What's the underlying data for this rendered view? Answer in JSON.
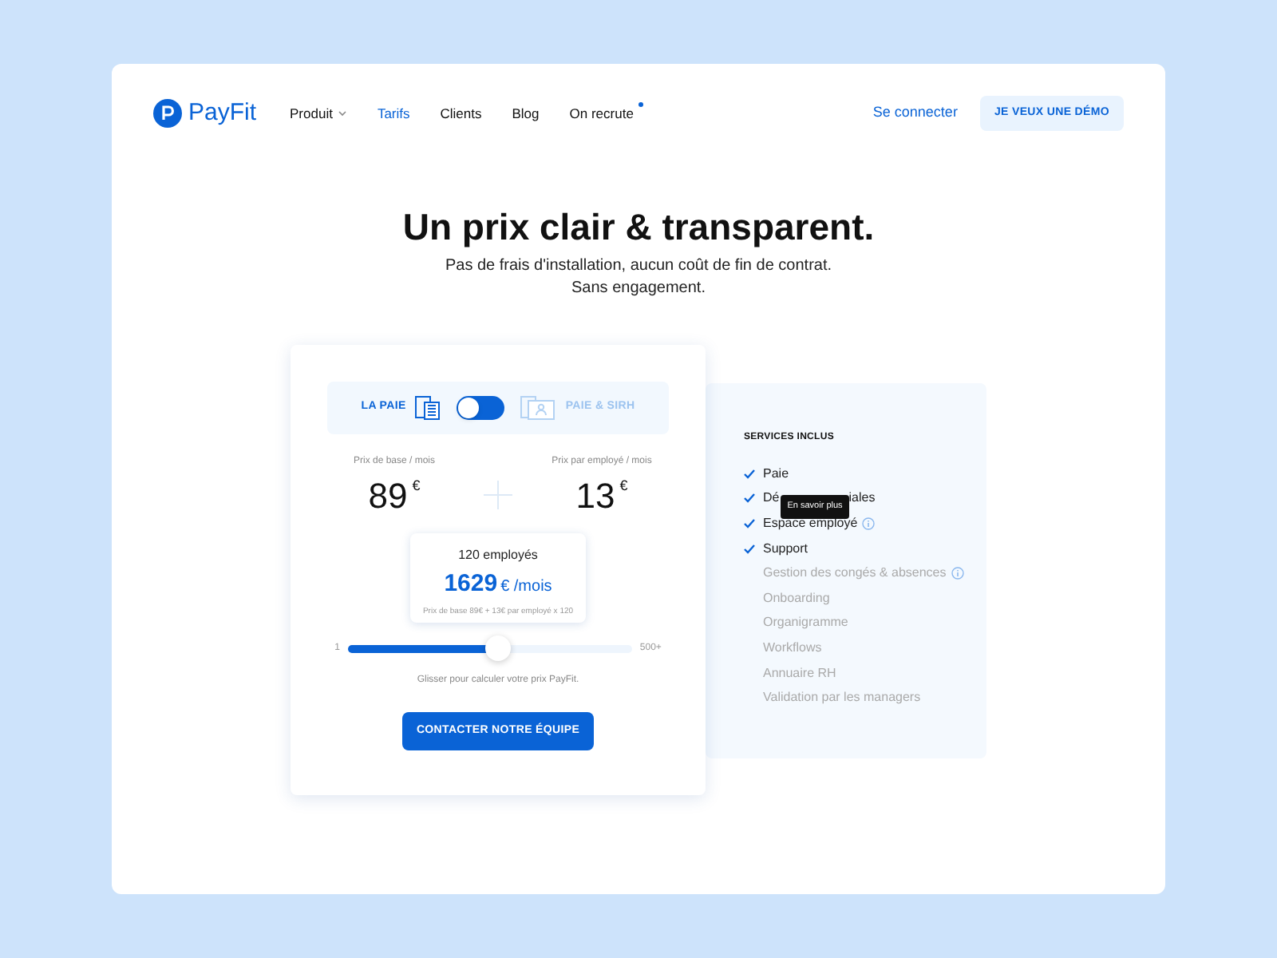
{
  "brand": "PayFit",
  "nav": [
    {
      "label": "Produit",
      "selected": false,
      "dropdown": true,
      "dot": false
    },
    {
      "label": "Tarifs",
      "selected": true,
      "dropdown": false,
      "dot": false
    },
    {
      "label": "Clients",
      "selected": false,
      "dropdown": false,
      "dot": false
    },
    {
      "label": "Blog",
      "selected": false,
      "dropdown": false,
      "dot": false
    },
    {
      "label": "On recrute",
      "selected": false,
      "dropdown": false,
      "dot": true
    }
  ],
  "login": "Se connecter",
  "demo_button": "JE VEUX UNE DÉMO",
  "headline": "Un prix clair & transparent.",
  "subtitle": [
    "Pas de frais d'installation, aucun coût de fin de contrat.",
    "Sans engagement."
  ],
  "plan_toggle": {
    "options": [
      {
        "label": "LA PAIE",
        "selected": true
      },
      {
        "label": "PAIE & SIRH",
        "selected": false
      }
    ],
    "on": false
  },
  "prices": [
    {
      "label": "Prix de base / mois",
      "amount": "89",
      "currency": "€"
    },
    {
      "label": "Prix par employé / mois",
      "amount": "13",
      "currency": "€"
    }
  ],
  "estimate": {
    "employees": "120 employés",
    "total": "1629",
    "unit": "€ /mois",
    "detail": "Prix de base 89€ + 13€ par employé x 120"
  },
  "slider": {
    "min": "1",
    "max": "500+",
    "level": 0.53,
    "hint": "Glisser pour calculer votre prix PayFit."
  },
  "cta": "CONTACTER NOTRE ÉQUIPE",
  "services": {
    "title": "SERVICES INCLUS",
    "items": [
      {
        "label": "Paie",
        "included": true,
        "info": false
      },
      {
        "visible_start": "Dé",
        "visible_end": "iales",
        "included": true,
        "info": false,
        "tooltip": "En savoir plus"
      },
      {
        "label": "Espace employé",
        "included": true,
        "info": true
      },
      {
        "label": "Support",
        "included": true,
        "info": false
      },
      {
        "label": "Gestion des congés & absences",
        "included": false,
        "info": true
      },
      {
        "label": "Onboarding",
        "included": false,
        "info": false
      },
      {
        "label": "Organigramme",
        "included": false,
        "info": false
      },
      {
        "label": "Workflows",
        "included": false,
        "info": false
      },
      {
        "label": "Annuaire RH",
        "included": false,
        "info": false
      },
      {
        "label": "Validation par les managers",
        "included": false,
        "info": false
      }
    ]
  }
}
